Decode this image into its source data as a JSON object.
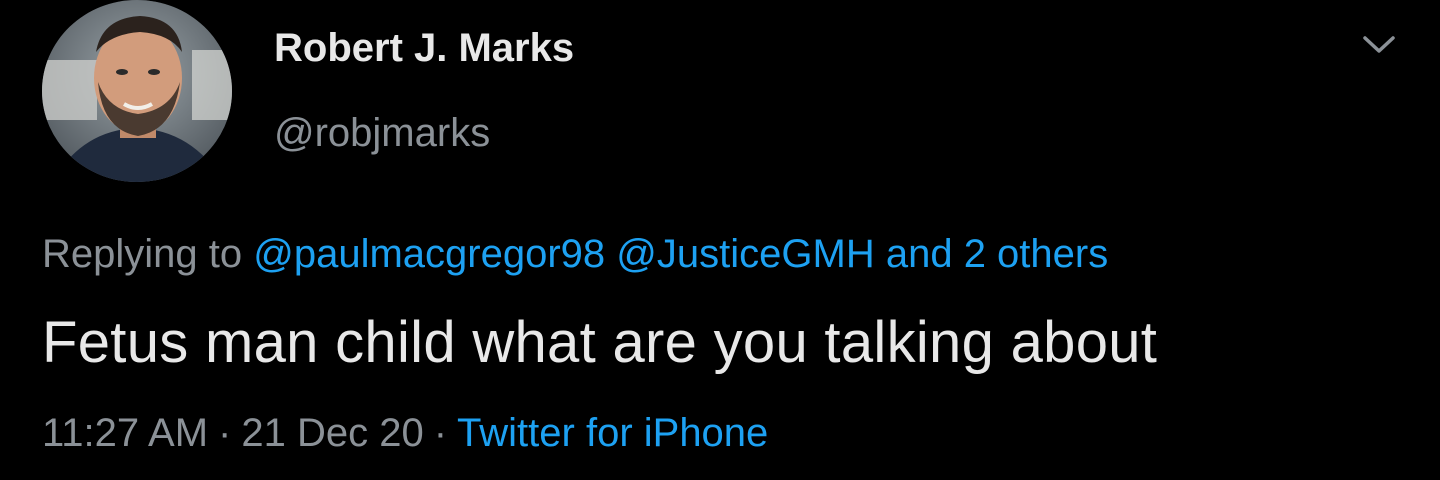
{
  "author": {
    "display_name": "Robert J. Marks",
    "handle": "@robjmarks",
    "avatar_icon": "profile-photo"
  },
  "more_icon": "chevron-down-icon",
  "reply": {
    "prefix": "Replying to",
    "mention_1": "@paulmacgregor98",
    "mention_2": "@JusticeGMH",
    "others": "and 2 others"
  },
  "tweet": {
    "text": "Fetus man child what are you talking about"
  },
  "meta": {
    "time": "11:27 AM",
    "date": "21 Dec 20",
    "separator": "·",
    "source": "Twitter for iPhone"
  },
  "colors": {
    "background": "#000000",
    "link": "#1da1f2",
    "secondary_text": "#8b9197",
    "primary_text": "#e8e8e8"
  }
}
